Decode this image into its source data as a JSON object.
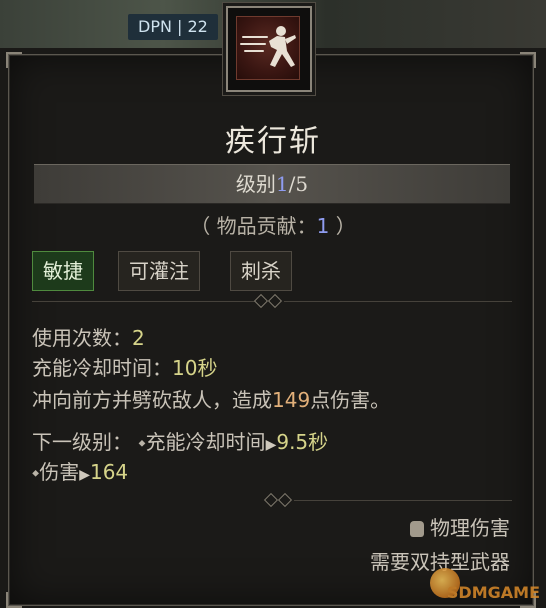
{
  "header": {
    "badge": "DPN | 22"
  },
  "skill": {
    "icon": "dash-attack-icon",
    "name": "疾行斩",
    "level_label": "级别",
    "level_current": "1",
    "level_max": "/5",
    "contrib_open": "（ 物品贡献：",
    "contrib_value": "1",
    "contrib_close": " ）",
    "tags": [
      "敏捷",
      "可灌注",
      "刺杀"
    ]
  },
  "stats": {
    "uses_label": "使用次数：",
    "uses_value": "2",
    "cooldown_label": "充能冷却时间：",
    "cooldown_value": "10秒",
    "desc_pre": "冲向前方并劈砍敌人，造成",
    "desc_value": "149",
    "desc_post": "点伤害。",
    "next_label": "下一级别：",
    "next_cd_label": "充能冷却时间",
    "next_cd_value": "9.5秒",
    "next_dmg_label": "伤害",
    "next_dmg_value": "164"
  },
  "footer": {
    "damage_type": "物理伤害",
    "requirement": "需要双持型武器"
  },
  "watermark": {
    "text": "SDMGAME"
  },
  "colors": {
    "tag_active": "#1d3a1b",
    "level_highlight": "#8f9cf0",
    "value_highlight": "#d6d48a"
  }
}
